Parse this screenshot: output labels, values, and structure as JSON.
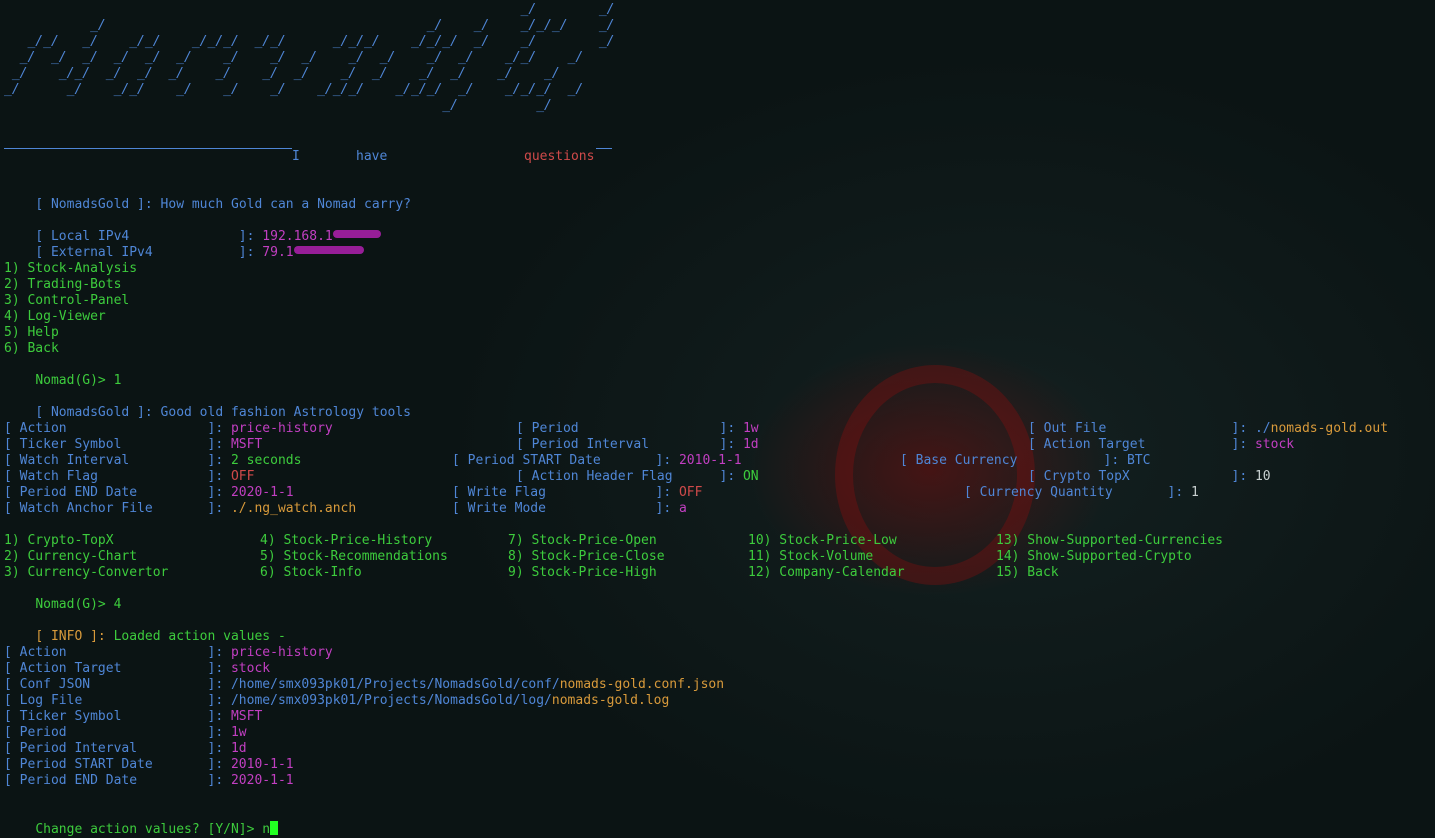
{
  "banner": {
    "ascii": "                                                                  _/        _/\n           _/                                         _/    _/    _/_/_/    _/\n   _/_/   _/    _/_/    _/_/_/  _/_/      _/_/_/    _/_/_/  _/    _/        _/\n  _/  _/  _/  _/  _/  _/    _/    _/  _/    _/  _/    _/  _/    _/_/    _/\n _/    _/_/  _/  _/  _/    _/    _/  _/    _/  _/    _/  _/    _/    _/\n_/      _/    _/_/    _/    _/    _/    _/_/_/    _/_/_/  _/    _/_/_/  _/\n                                                        _/          _/",
    "tag_i": "I",
    "tag_have": "have",
    "tag_questions": "questions"
  },
  "colors": {
    "blue": "#4f86d6",
    "green": "#3dcc3d",
    "magenta": "#c23fc2",
    "red": "#d04a4a",
    "orange": "#d89a3b",
    "background": "#0b1414"
  },
  "intro": {
    "prefix": "[ NomadsGold ]:",
    "text": "How much Gold can a Nomad carry?"
  },
  "network": [
    {
      "label": "[ Local IPv4              ]:",
      "value": "192.168.1"
    },
    {
      "label": "[ External IPv4           ]:",
      "value": "79.1"
    }
  ],
  "main_menu": [
    "1) Stock-Analysis",
    "2) Trading-Bots",
    "3) Control-Panel",
    "4) Log-Viewer",
    "5) Help",
    "6) Back"
  ],
  "prompt1": {
    "prompt": "Nomad(G)>",
    "input": "1"
  },
  "section2": {
    "prefix": "[ NomadsGold ]:",
    "text": "Good old fashion Astrology tools"
  },
  "settings": {
    "action": {
      "label": "[ Action                  ]:",
      "value": "price-history"
    },
    "ticker": {
      "label": "[ Ticker Symbol           ]:",
      "value": "MSFT"
    },
    "watch_interval": {
      "label": "[ Watch Interval          ]:",
      "value": "2 seconds"
    },
    "watch_flag": {
      "label": "[ Watch Flag              ]:",
      "value": "OFF"
    },
    "period_end": {
      "label": "[ Period END Date         ]:",
      "value": "2020-1-1"
    },
    "watch_anchor": {
      "label": "[ Watch Anchor File       ]:",
      "value": "./.ng_watch.anch"
    },
    "period": {
      "label": "[ Period                  ]:",
      "value": "1w"
    },
    "period_interval": {
      "label": "[ Period Interval         ]:",
      "value": "1d"
    },
    "period_start": {
      "label": "[ Period START Date       ]:",
      "value": "2010-1-1"
    },
    "action_header_flag": {
      "label": "[ Action Header Flag      ]:",
      "value": "ON"
    },
    "write_flag": {
      "label": "[ Write Flag              ]:",
      "value": "OFF"
    },
    "write_mode": {
      "label": "[ Write Mode              ]:",
      "value": "a"
    },
    "out_file": {
      "label": "[ Out File                ]:",
      "value_prefix": "./",
      "value": "nomads-gold.out"
    },
    "action_target": {
      "label": "[ Action Target           ]:",
      "value": "stock"
    },
    "base_currency": {
      "label": "[ Base Currency           ]:",
      "value": "BTC"
    },
    "crypto_topx": {
      "label": "[ Crypto TopX             ]:",
      "value": "10"
    },
    "currency_quantity": {
      "label": "[ Currency Quantity       ]:",
      "value": "1"
    }
  },
  "action_menu": {
    "col1": [
      "1) Crypto-TopX",
      "2) Currency-Chart",
      "3) Currency-Convertor"
    ],
    "col2": [
      "4) Stock-Price-History",
      "5) Stock-Recommendations",
      "6) Stock-Info"
    ],
    "col3": [
      "7) Stock-Price-Open",
      "8) Stock-Price-Close",
      "9) Stock-Price-High"
    ],
    "col4": [
      "10) Stock-Price-Low",
      "11) Stock-Volume",
      "12) Company-Calendar"
    ],
    "col5": [
      "13) Show-Supported-Currencies",
      "14) Show-Supported-Crypto",
      "15) Back"
    ]
  },
  "prompt2": {
    "prompt": "Nomad(G)>",
    "input": "4"
  },
  "info": {
    "prefix": "[ INFO ]:",
    "text": "Loaded action values -"
  },
  "loaded": {
    "action": {
      "label": "[ Action                  ]:",
      "value": "price-history"
    },
    "action_target": {
      "label": "[ Action Target           ]:",
      "value": "stock"
    },
    "conf_json": {
      "label": "[ Conf JSON               ]:",
      "path": "/home/smx093pk01/Projects/NomadsGold/conf/",
      "file": "nomads-gold.conf.json"
    },
    "log_file": {
      "label": "[ Log File                ]:",
      "path": "/home/smx093pk01/Projects/NomadsGold/log/",
      "file": "nomads-gold.log"
    },
    "ticker": {
      "label": "[ Ticker Symbol           ]:",
      "value": "MSFT"
    },
    "period": {
      "label": "[ Period                  ]:",
      "value": "1w"
    },
    "period_interval": {
      "label": "[ Period Interval         ]:",
      "value": "1d"
    },
    "period_start": {
      "label": "[ Period START Date       ]:",
      "value": "2010-1-1"
    },
    "period_end": {
      "label": "[ Period END Date         ]:",
      "value": "2020-1-1"
    }
  },
  "final_prompt": {
    "text": "Change action values? [Y/N]>",
    "input": "n"
  }
}
